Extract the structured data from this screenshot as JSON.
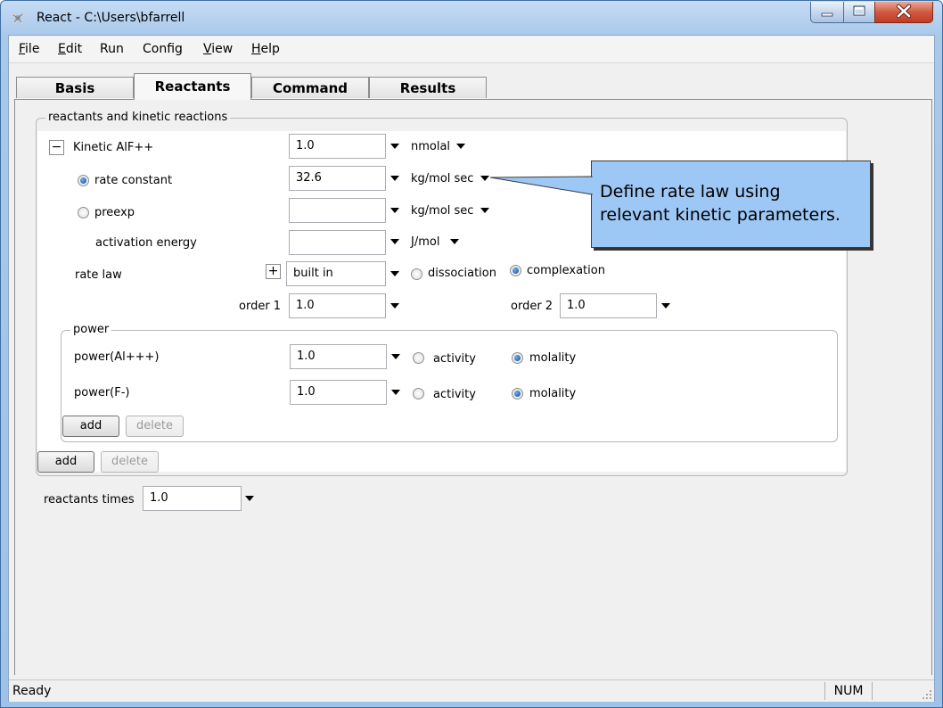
{
  "window": {
    "title": "React - C:\\Users\\bfarrell"
  },
  "menu": [
    {
      "label": "File",
      "mnemonic": "F",
      "rest": "ile"
    },
    {
      "label": "Edit",
      "mnemonic": "E",
      "rest": "dit"
    },
    {
      "label": "Run",
      "mnemonic": "",
      "rest": "Run"
    },
    {
      "label": "Config",
      "mnemonic": "",
      "rest": "Config"
    },
    {
      "label": "View",
      "mnemonic": "V",
      "rest": "iew"
    },
    {
      "label": "Help",
      "mnemonic": "H",
      "rest": "elp"
    }
  ],
  "tabs": [
    "Basis",
    "Reactants",
    "Command",
    "Results"
  ],
  "active_tab": "Reactants",
  "reactants_group": {
    "legend": "reactants and kinetic reactions",
    "kinetic": {
      "collapse_symbol": "−",
      "label": "Kinetic  AlF++",
      "amount": "1.0",
      "amount_unit": "nmolal",
      "rate_constant_label": "rate constant",
      "rate_constant_value": "32.6",
      "rate_constant_unit": "kg/mol sec",
      "preexp_label": "preexp",
      "preexp_value": "",
      "preexp_unit": "kg/mol sec",
      "activation_energy_label": "activation energy",
      "activation_energy_value": "",
      "activation_energy_unit": "J/mol",
      "rate_law_label": "rate law",
      "rate_law_expand_symbol": "+",
      "rate_law_value": "built in",
      "dissociation_label": "dissociation",
      "complexation_label": "complexation",
      "order1_label": "order 1",
      "order1_value": "1.0",
      "order2_label": "order 2",
      "order2_value": "1.0"
    },
    "power_group": {
      "legend": "power",
      "rows": [
        {
          "label": "power(Al+++)",
          "value": "1.0",
          "activity_label": "activity",
          "molality_label": "molality"
        },
        {
          "label": "power(F-)",
          "value": "1.0",
          "activity_label": "activity",
          "molality_label": "molality"
        }
      ],
      "add_label": "add",
      "delete_label": "delete"
    },
    "add_label": "add",
    "delete_label": "delete"
  },
  "reactants_times": {
    "label": "reactants times",
    "value": "1.0"
  },
  "callout": {
    "line1": "Define rate law using",
    "line2": "relevant kinetic parameters."
  },
  "status": {
    "text": "Ready",
    "num": "NUM"
  },
  "colors": {
    "callout_fill": "#9dc7f4",
    "titlebar": "#b9d3f0",
    "close_button": "#c9452b"
  }
}
